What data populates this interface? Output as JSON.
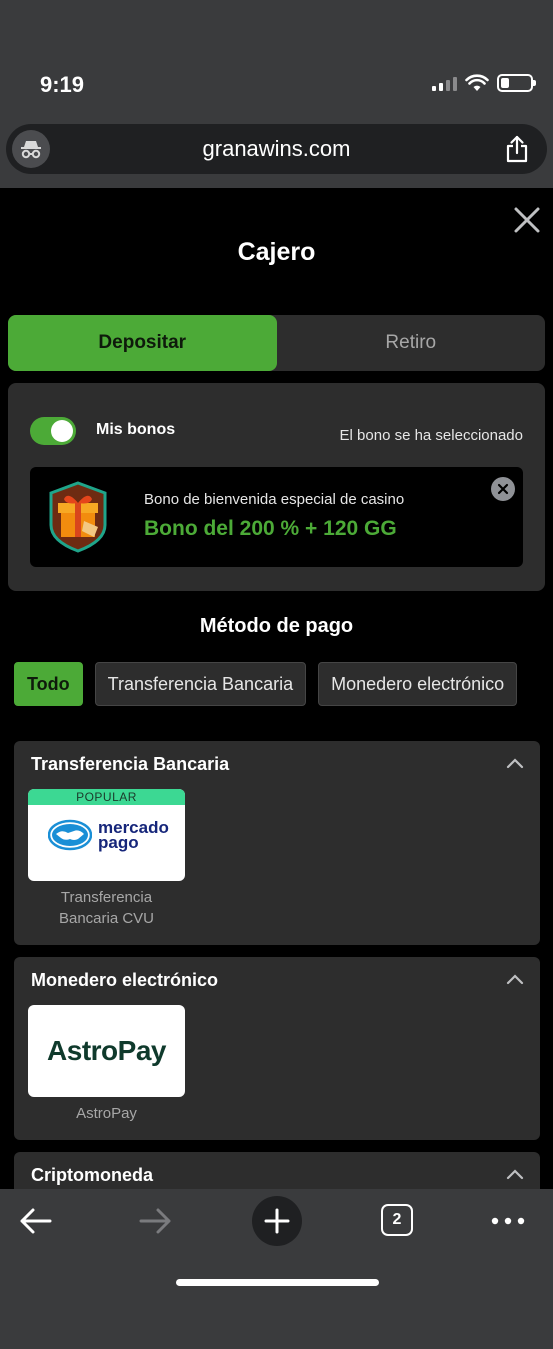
{
  "status": {
    "time": "9:19"
  },
  "browser": {
    "url": "granawins.com",
    "tab_count": "2"
  },
  "cashier": {
    "title": "Cajero",
    "tabs": [
      {
        "label": "Depositar",
        "active": true
      },
      {
        "label": "Retiro",
        "active": false
      }
    ],
    "bonus": {
      "toggle_label": "Mis bonos",
      "toggle_on": true,
      "status_text": "El bono se ha seleccionado",
      "description": "Bono de bienvenida especial de casino",
      "amount": "Bono del 200 % + 120 GG"
    },
    "payment": {
      "title": "Método de pago",
      "filters": [
        "Todo",
        "Transferencia Bancaria",
        "Monedero electrónico"
      ],
      "sections": [
        {
          "title": "Transferencia Bancaria",
          "methods": [
            {
              "badge": "POPULAR",
              "logo_lines": [
                "mercado",
                "pago"
              ],
              "label_lines": [
                "Transferencia",
                "Bancaria CVU"
              ]
            }
          ]
        },
        {
          "title": "Monedero electrónico",
          "methods": [
            {
              "logo_text": "AstroPay",
              "label": "AstroPay"
            }
          ]
        },
        {
          "title": "Criptomoneda"
        }
      ]
    }
  },
  "colors": {
    "accent": "#4caa37",
    "popular": "#3cd893",
    "panel": "#2d2d2d"
  }
}
